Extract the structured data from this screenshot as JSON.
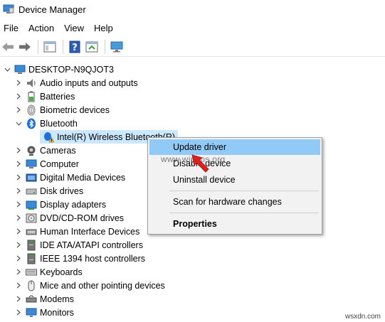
{
  "window": {
    "title": "Device Manager"
  },
  "menu": [
    "File",
    "Action",
    "View",
    "Help"
  ],
  "toolbar": {
    "buttons": [
      "back-icon",
      "forward-icon",
      "properties-grid-icon",
      "help-icon",
      "update-icon",
      "monitor-icon"
    ]
  },
  "tree": {
    "root": "DESKTOP-N9QJOT3",
    "items": [
      {
        "label": "Audio inputs and outputs",
        "icon": "speaker-icon",
        "expanded": false
      },
      {
        "label": "Batteries",
        "icon": "battery-icon",
        "expanded": false
      },
      {
        "label": "Biometric devices",
        "icon": "fingerprint-icon",
        "expanded": false
      },
      {
        "label": "Bluetooth",
        "icon": "bluetooth-icon",
        "expanded": true
      },
      {
        "label": "Intel(R) Wireless Bluetooth(R)",
        "icon": "warning-icon",
        "child": true
      },
      {
        "label": "Cameras",
        "icon": "camera-icon",
        "expanded": false
      },
      {
        "label": "Computer",
        "icon": "computer-icon",
        "expanded": false
      },
      {
        "label": "Digital Media Devices",
        "icon": "media-device-icon",
        "expanded": false
      },
      {
        "label": "Disk drives",
        "icon": "disk-drive-icon",
        "expanded": false
      },
      {
        "label": "Display adapters",
        "icon": "display-adapter-icon",
        "expanded": false
      },
      {
        "label": "DVD/CD-ROM drives",
        "icon": "dvd-icon",
        "expanded": false
      },
      {
        "label": "Human Interface Devices",
        "icon": "hid-icon",
        "expanded": false
      },
      {
        "label": "IDE ATA/ATAPI controllers",
        "icon": "ide-controller-icon",
        "expanded": false
      },
      {
        "label": "IEEE 1394 host controllers",
        "icon": "ieee1394-icon",
        "expanded": false
      },
      {
        "label": "Keyboards",
        "icon": "keyboard-icon",
        "expanded": false
      },
      {
        "label": "Mice and other pointing devices",
        "icon": "mouse-icon",
        "expanded": false
      },
      {
        "label": "Modems",
        "icon": "modem-icon",
        "expanded": false
      },
      {
        "label": "Monitors",
        "icon": "monitor-icon",
        "expanded": false
      }
    ]
  },
  "context_menu": {
    "items": [
      {
        "label": "Update driver",
        "highlighted": true
      },
      {
        "label": "Disable device"
      },
      {
        "label": "Uninstall device"
      },
      {
        "label": "Scan for hardware changes"
      },
      {
        "label": "Properties",
        "bold": true
      }
    ]
  },
  "watermarks": {
    "center": "www.wintips.org",
    "corner": "wsxdn.com"
  },
  "colors": {
    "selection": "#cce8ff",
    "menu_highlight": "#91c9f7",
    "arrow": "#e0201b"
  }
}
